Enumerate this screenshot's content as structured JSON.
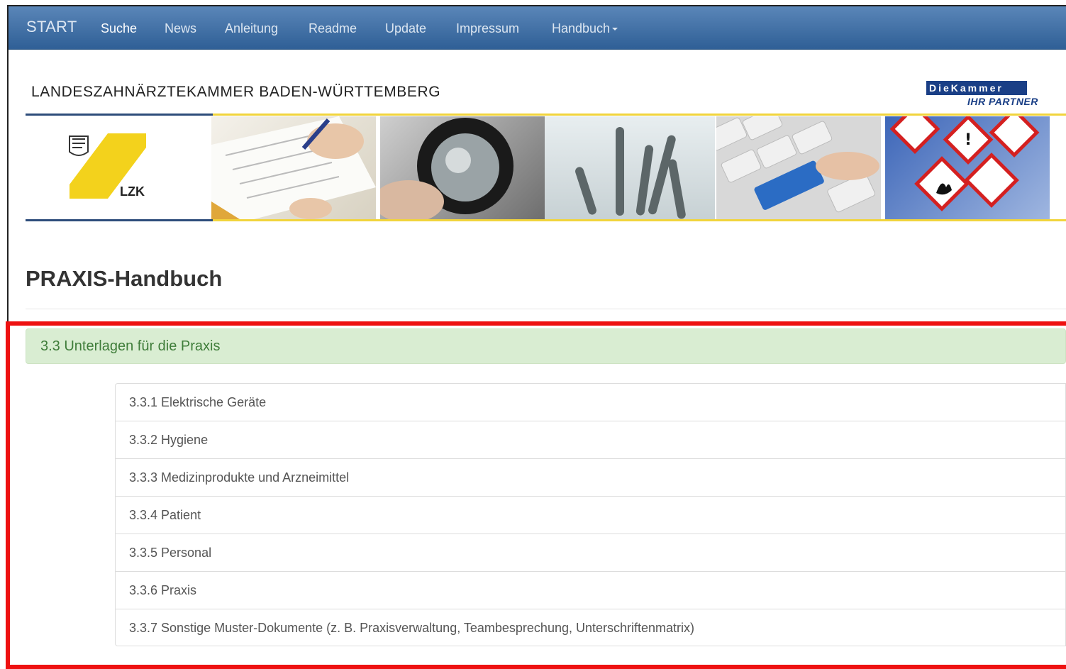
{
  "navbar": {
    "brand": "START",
    "items": [
      {
        "label": "Suche",
        "active": true
      },
      {
        "label": "News"
      },
      {
        "label": "Anleitung"
      },
      {
        "label": "Readme"
      },
      {
        "label": "Update"
      },
      {
        "label": "Impressum"
      },
      {
        "label": "Handbuch",
        "dropdown": true
      }
    ]
  },
  "header": {
    "org_name": "LANDESZAHNÄRZTEKAMMER BADEN-WÜRTTEMBERG",
    "logo_top": "DieKammer",
    "logo_bottom": "IHR PARTNER",
    "lzk_label": "LZK"
  },
  "page": {
    "title": "PRAXIS-Handbuch"
  },
  "section": {
    "heading": "3.3 Unterlagen für die Praxis",
    "items": [
      "3.3.1 Elektrische Geräte",
      "3.3.2 Hygiene",
      "3.3.3 Medizinprodukte und Arzneimittel",
      "3.3.4 Patient",
      "3.3.5 Personal",
      "3.3.6 Praxis",
      "3.3.7 Sonstige Muster-Dokumente (z. B. Praxisverwaltung, Teambesprechung, Unterschriftenmatrix)"
    ]
  },
  "colors": {
    "navbar_top": "#5a86b8",
    "navbar_bottom": "#2f5f96",
    "section_bg": "#d9edd2",
    "section_text": "#3f7d3a",
    "highlight_border": "#ee1111",
    "accent_yellow": "#f1d43c"
  }
}
